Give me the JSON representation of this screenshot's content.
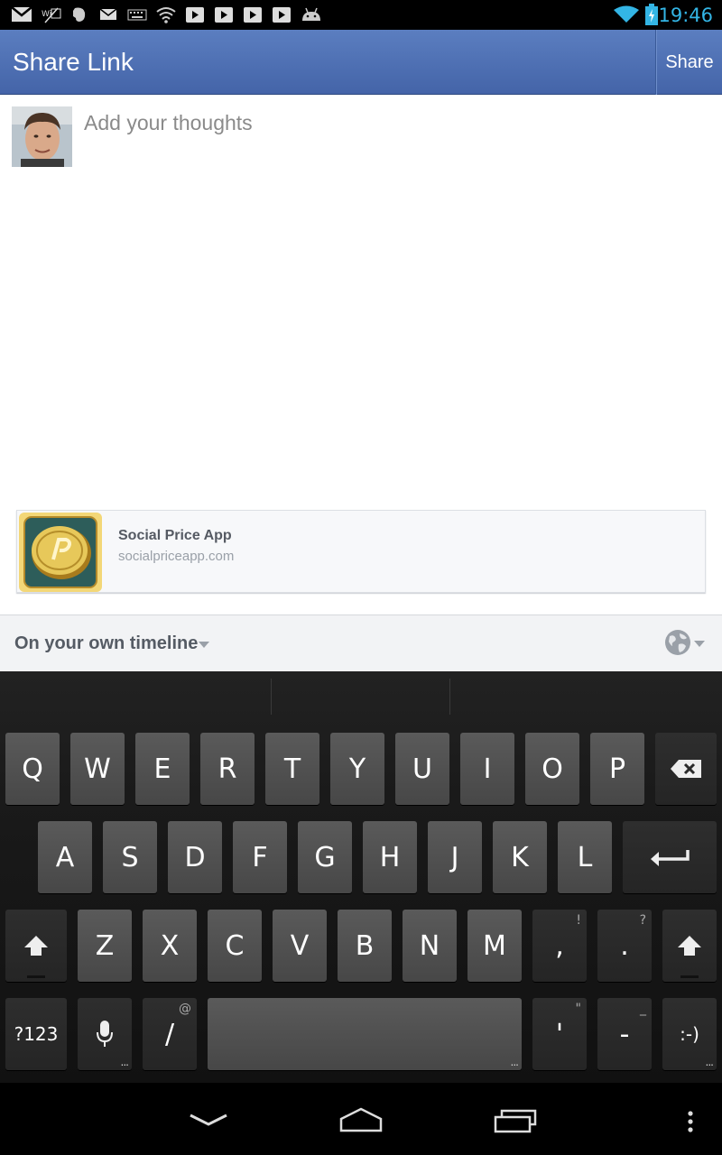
{
  "status_bar": {
    "time": "19:46",
    "icons": [
      "gmail-icon",
      "wifi-sign-icon",
      "evernote-icon",
      "mail-icon",
      "keyboard-icon",
      "wifi-icon",
      "play-icon",
      "play-icon",
      "play-icon",
      "play-icon",
      "android-icon",
      "wifi-signal-icon",
      "battery-charging-icon"
    ],
    "accent_color": "#33b5e5"
  },
  "action_bar": {
    "title": "Share Link",
    "share_label": "Share",
    "color": "#4f71b4"
  },
  "compose": {
    "placeholder": "Add your thoughts"
  },
  "link_card": {
    "title": "Social Price App",
    "url": "socialpriceapp.com"
  },
  "audience": {
    "label": "On your own timeline"
  },
  "keyboard": {
    "rows": [
      [
        "Q",
        "W",
        "E",
        "R",
        "T",
        "Y",
        "U",
        "I",
        "O",
        "P"
      ],
      [
        "A",
        "S",
        "D",
        "F",
        "G",
        "H",
        "J",
        "K",
        "L"
      ],
      [
        "Z",
        "X",
        "C",
        "V",
        "B",
        "N",
        "M",
        ",",
        "."
      ]
    ],
    "row3_hints": [
      "!",
      "?"
    ],
    "bottom": {
      "symbols": "?123",
      "slash": "/",
      "slash_hint": "@",
      "apostrophe": "'",
      "apostrophe_hint": "\"",
      "dash": "-",
      "dash_hint": "_",
      "smiley": ":-)"
    }
  }
}
